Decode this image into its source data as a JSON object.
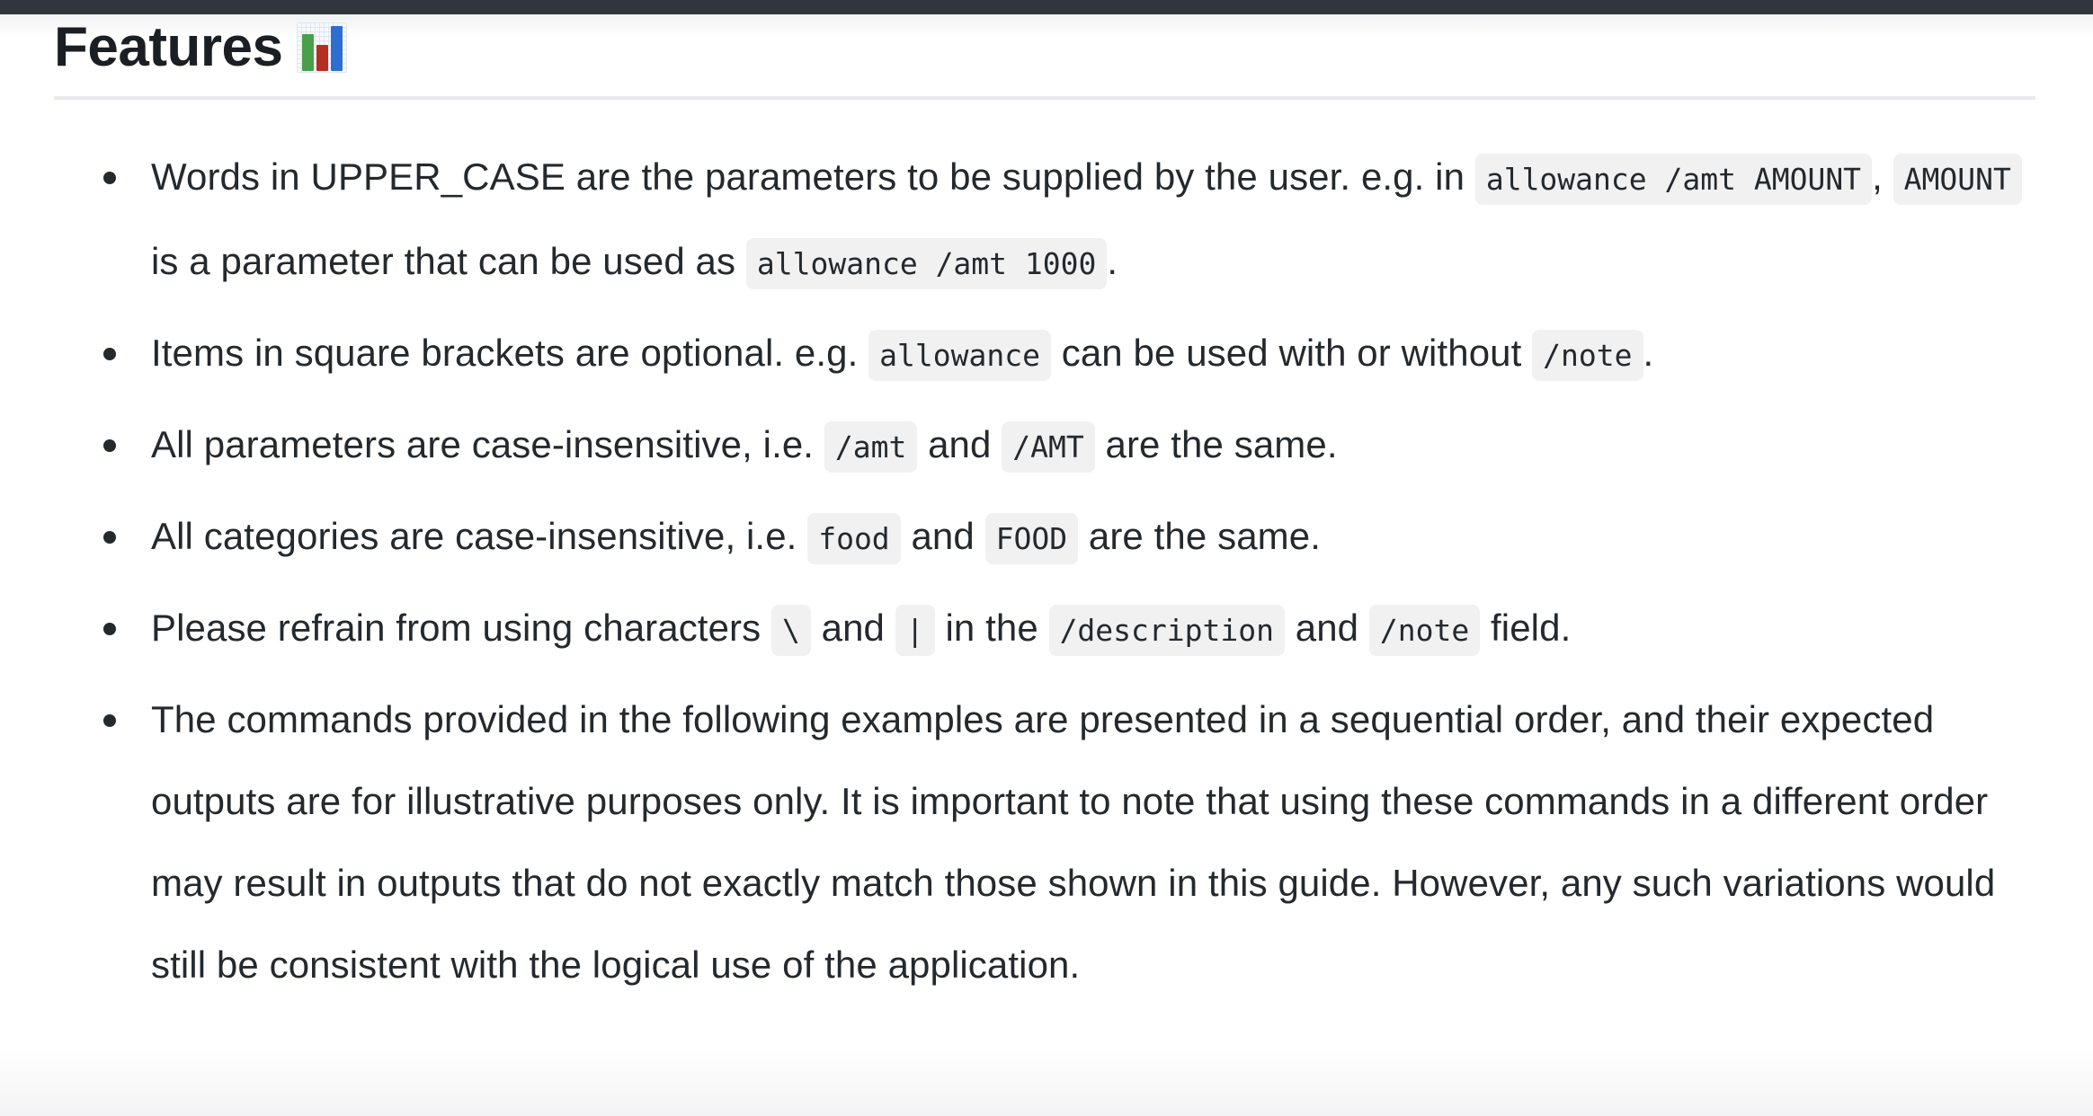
{
  "navbar": {
    "present": true,
    "background": "#2f363d"
  },
  "header": {
    "title": "Features",
    "emoji_name": "bar-chart-emoji",
    "emoji_bars": [
      {
        "color": "#4aa04a",
        "name": "green-bar"
      },
      {
        "color": "#b32f22",
        "name": "red-bar"
      },
      {
        "color": "#2c6fd1",
        "name": "blue-bar"
      }
    ]
  },
  "colors": {
    "text": "#24292e",
    "heading": "#1b1f23",
    "code_background": "#f1f1f1",
    "rule": "#e9eaee",
    "navbar": "#2f363d"
  },
  "features": {
    "item1": {
      "t1": "Words in UPPER_CASE are the parameters to be supplied by the user. e.g. in ",
      "c1": "allowance /amt AMOUNT",
      "t2": ", ",
      "c2": "AMOUNT",
      "t3": " is a parameter that can be used as ",
      "c3": "allowance /amt 1000",
      "t4": "."
    },
    "item2": {
      "t1": "Items in square brackets are optional. e.g. ",
      "c1": "allowance",
      "t2": " can be used with or without ",
      "c2": "/note",
      "t3": "."
    },
    "item3": {
      "t1": "All parameters are case-insensitive, i.e. ",
      "c1": "/amt",
      "t2": " and ",
      "c2": "/AMT",
      "t3": " are the same."
    },
    "item4": {
      "t1": "All categories are case-insensitive, i.e. ",
      "c1": "food",
      "t2": " and ",
      "c2": "FOOD",
      "t3": " are the same."
    },
    "item5": {
      "t1": "Please refrain from using characters ",
      "c1": "\\",
      "t2": " and ",
      "c2": "|",
      "t3": " in the ",
      "c3": "/description",
      "t4": " and ",
      "c4": "/note",
      "t5": " field."
    },
    "item6": {
      "t1": "The commands provided in the following examples are presented in a sequential order, and their expected outputs are for illustrative purposes only. It is important to note that using these commands in a different order may result in outputs that do not exactly match those shown in this guide. However, any such variations would still be consistent with the logical use of the application."
    }
  }
}
